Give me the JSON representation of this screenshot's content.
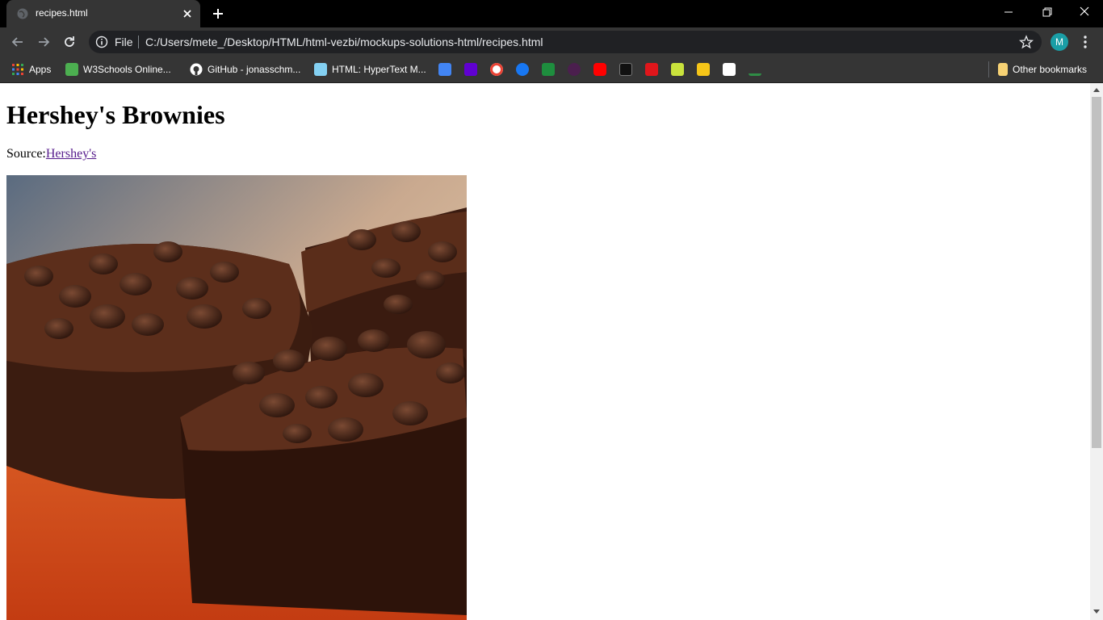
{
  "tab": {
    "title": "recipes.html"
  },
  "omnibox": {
    "scheme_label": "File",
    "url": "C:/Users/mete_/Desktop/HTML/html-vezbi/mockups-solutions-html/recipes.html"
  },
  "profile": {
    "initial": "M",
    "color": "#1a9ea6"
  },
  "bookmarks": {
    "apps": "Apps",
    "items": [
      "W3Schools Online...",
      "GitHub - jonasschm...",
      "HTML: HyperText M..."
    ],
    "icon_only": [
      "contacts-icon",
      "yahoo-icon",
      "google-icon",
      "facebook-icon",
      "refresh-green-icon",
      "eggplant-icon",
      "youtube-icon",
      "gol-icon",
      "t-icon",
      "m-icon",
      "imdb-icon",
      "s-icon",
      "link-icon"
    ],
    "other": "Other bookmarks"
  },
  "page": {
    "heading": "Hershey's Brownies",
    "source_label": "Source:",
    "source_link": "Hershey's",
    "image_alt": "brownies-photo"
  }
}
